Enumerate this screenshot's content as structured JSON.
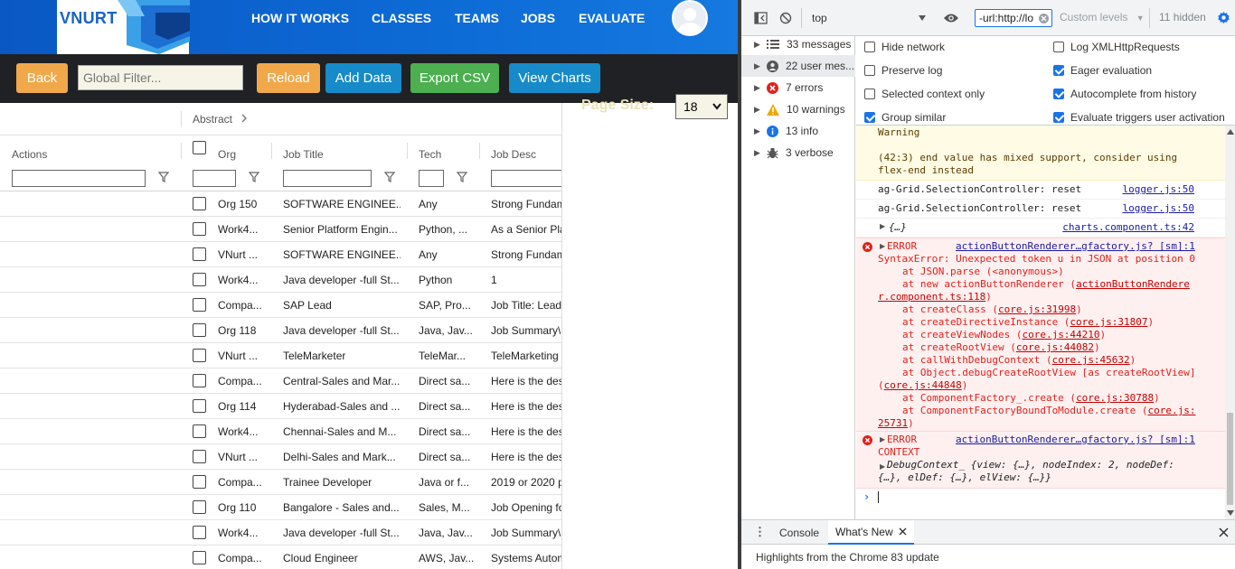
{
  "app": {
    "logo": "VNURT",
    "nav": [
      "HOW IT WORKS",
      "CLASSES",
      "TEAMS",
      "JOBS",
      "EVALUATE"
    ],
    "toolbar": {
      "back": "Back",
      "filter_placeholder": "Global Filter...",
      "reload": "Reload",
      "add_data": "Add Data",
      "export_csv": "Export CSV",
      "view_charts": "View Charts"
    },
    "page_size_label": "Page Size:",
    "page_size_value": "18",
    "grid": {
      "group_header": "Abstract",
      "columns": [
        "Actions",
        "Org",
        "Job Title",
        "Tech",
        "Job Desc"
      ],
      "rows": [
        {
          "org": "Org 150",
          "title": "SOFTWARE ENGINEE...",
          "tech": "Any",
          "desc": "Strong Fundam"
        },
        {
          "org": "Work4...",
          "title": "Senior Platform Engin...",
          "tech": "Python, ...",
          "desc": "As a Senior Pla"
        },
        {
          "org": "VNurt ...",
          "title": "SOFTWARE ENGINEE...",
          "tech": "Any",
          "desc": "Strong Fundam"
        },
        {
          "org": "Work4...",
          "title": "Java developer -full St...",
          "tech": "Python",
          "desc": "1"
        },
        {
          "org": "Compa...",
          "title": "SAP Lead",
          "tech": "SAP, Pro...",
          "desc": "Job Title: Lead"
        },
        {
          "org": "Org 118",
          "title": "Java developer -full St...",
          "tech": "Java, Jav...",
          "desc": "Job Summary\\"
        },
        {
          "org": "VNurt ...",
          "title": "TeleMarketer",
          "tech": "TeleMar...",
          "desc": "TeleMarketing"
        },
        {
          "org": "Compa...",
          "title": "Central-Sales and Mar...",
          "tech": "Direct sa...",
          "desc": "Here is the des"
        },
        {
          "org": "Org 114",
          "title": "Hyderabad-Sales and ...",
          "tech": "Direct sa...",
          "desc": "Here is the des"
        },
        {
          "org": "Work4...",
          "title": "Chennai-Sales and M...",
          "tech": "Direct sa...",
          "desc": "Here is the des"
        },
        {
          "org": "VNurt ...",
          "title": "Delhi-Sales and Mark...",
          "tech": "Direct sa...",
          "desc": "Here is the des"
        },
        {
          "org": "Compa...",
          "title": "Trainee Developer",
          "tech": "Java or f...",
          "desc": "2019 or 2020 p"
        },
        {
          "org": "Org 110",
          "title": "Bangalore - Sales and...",
          "tech": "Sales, M...",
          "desc": "Job Opening fo"
        },
        {
          "org": "Work4...",
          "title": "Java developer -full St...",
          "tech": "Java, Jav...",
          "desc": "Job Summary\\"
        },
        {
          "org": "Compa...",
          "title": "Cloud Engineer",
          "tech": "AWS, Jav...",
          "desc": "Systems Autom"
        }
      ]
    }
  },
  "devtools": {
    "context": "top",
    "filter_value": "-url:http://lo",
    "levels": "Custom levels",
    "hidden": "11 hidden",
    "sidebar": [
      {
        "label": "33 messages",
        "icon": "list-icon"
      },
      {
        "label": "22 user mes...",
        "icon": "user-icon"
      },
      {
        "label": "7 errors",
        "icon": "error-icon"
      },
      {
        "label": "10 warnings",
        "icon": "warning-icon"
      },
      {
        "label": "13 info",
        "icon": "info-icon"
      },
      {
        "label": "3 verbose",
        "icon": "bug-icon"
      }
    ],
    "settings_left": [
      {
        "label": "Hide network",
        "checked": false
      },
      {
        "label": "Preserve log",
        "checked": false
      },
      {
        "label": "Selected context only",
        "checked": false
      },
      {
        "label": "Group similar",
        "checked": true
      }
    ],
    "settings_right": [
      {
        "label": "Log XMLHttpRequests",
        "checked": false
      },
      {
        "label": "Eager evaluation",
        "checked": true
      },
      {
        "label": "Autocomplete from history",
        "checked": true
      },
      {
        "label": "Evaluate triggers user activation",
        "checked": true
      }
    ],
    "console": {
      "warning_title": "Warning",
      "warning_text_1": "(42:3) end value has mixed support, consider using",
      "warning_text_2": "flex-end instead",
      "log1_text": "ag-Grid.SelectionController: reset",
      "log1_src": "logger.js:50",
      "log2_text": "ag-Grid.SelectionController: reset",
      "log2_src": "logger.js:50",
      "obj_text": "{…}",
      "obj_src": "charts.component.ts:42",
      "err1_label": "ERROR",
      "err1_src": "actionButtonRenderer…gfactory.js? [sm]:1",
      "err1_line": "SyntaxError: Unexpected token u in JSON at position 0",
      "stack": [
        {
          "pre": "at JSON.parse (<anonymous>)",
          "link": ""
        },
        {
          "pre": "at new actionButtonRenderer (",
          "link": "actionButtonRendere"
        },
        {
          "pre": "",
          "link": "r.component.ts:118",
          "post": ")"
        },
        {
          "pre": "at createClass (",
          "link": "core.js:31998",
          "post": ")"
        },
        {
          "pre": "at createDirectiveInstance (",
          "link": "core.js:31807",
          "post": ")"
        },
        {
          "pre": "at createViewNodes (",
          "link": "core.js:44210",
          "post": ")"
        },
        {
          "pre": "at createRootView (",
          "link": "core.js:44082",
          "post": ")"
        },
        {
          "pre": "at callWithDebugContext (",
          "link": "core.js:45632",
          "post": ")"
        },
        {
          "pre": "at Object.debugCreateRootView [as createRootView]",
          "link": ""
        },
        {
          "pre": "(",
          "link": "core.js:44848",
          "post": ")"
        },
        {
          "pre": "at ComponentFactory_.create (",
          "link": "core.js:30788",
          "post": ")"
        },
        {
          "pre": "at ComponentFactoryBoundToModule.create (",
          "link": "core.js:"
        },
        {
          "pre": "",
          "link": "25731",
          "post": ")"
        }
      ],
      "err2_label": "ERROR",
      "err2_src": "actionButtonRenderer…gfactory.js? [sm]:1",
      "err2_context": "CONTEXT",
      "err2_obj_1": "DebugContext_ {view: {…}, nodeIndex: 2, nodeDef:",
      "err2_obj_2": "{…}, elDef: {…}, elView: {…}}"
    },
    "drawer": {
      "tab_console": "Console",
      "tab_whats_new": "What's New",
      "highlights": "Highlights from the Chrome 83 update"
    }
  }
}
